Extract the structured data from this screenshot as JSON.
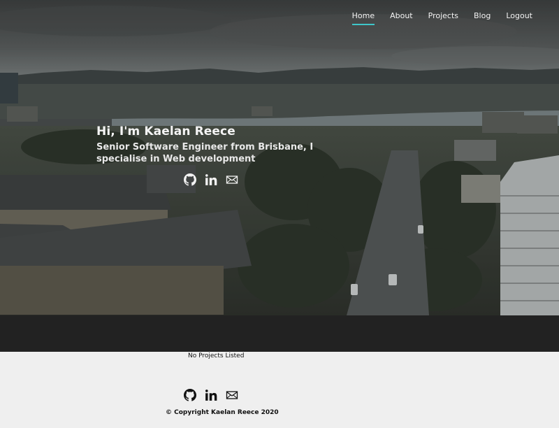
{
  "nav": {
    "items": [
      {
        "label": "Home",
        "active": true
      },
      {
        "label": "About",
        "active": false
      },
      {
        "label": "Projects",
        "active": false
      },
      {
        "label": "Blog",
        "active": false
      },
      {
        "label": "Logout",
        "active": false
      }
    ],
    "accent_color": "#3fc6c9"
  },
  "hero": {
    "heading": "Hi, I'm Kaelan Reece",
    "subheading": "Senior Software Engineer from Brisbane, I specialise in Web development",
    "background": "aerial-city-canal-photo",
    "social_icons": [
      "github-icon",
      "linkedin-icon",
      "mail-icon"
    ]
  },
  "projects": {
    "empty_message": "No Projects Listed"
  },
  "footer": {
    "social_icons": [
      "github-icon",
      "linkedin-icon",
      "mail-icon"
    ],
    "copyright": "© Copyright Kaelan Reece 2020"
  },
  "colors": {
    "band": "#222222",
    "page_bg": "#efefef"
  }
}
